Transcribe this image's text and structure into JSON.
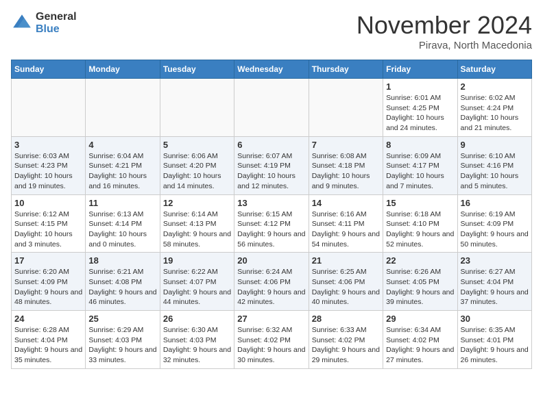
{
  "header": {
    "logo_general": "General",
    "logo_blue": "Blue",
    "month_title": "November 2024",
    "location": "Pirava, North Macedonia"
  },
  "days_of_week": [
    "Sunday",
    "Monday",
    "Tuesday",
    "Wednesday",
    "Thursday",
    "Friday",
    "Saturday"
  ],
  "weeks": [
    {
      "days": [
        {
          "num": "",
          "info": ""
        },
        {
          "num": "",
          "info": ""
        },
        {
          "num": "",
          "info": ""
        },
        {
          "num": "",
          "info": ""
        },
        {
          "num": "",
          "info": ""
        },
        {
          "num": "1",
          "info": "Sunrise: 6:01 AM\nSunset: 4:25 PM\nDaylight: 10 hours and 24 minutes."
        },
        {
          "num": "2",
          "info": "Sunrise: 6:02 AM\nSunset: 4:24 PM\nDaylight: 10 hours and 21 minutes."
        }
      ]
    },
    {
      "days": [
        {
          "num": "3",
          "info": "Sunrise: 6:03 AM\nSunset: 4:23 PM\nDaylight: 10 hours and 19 minutes."
        },
        {
          "num": "4",
          "info": "Sunrise: 6:04 AM\nSunset: 4:21 PM\nDaylight: 10 hours and 16 minutes."
        },
        {
          "num": "5",
          "info": "Sunrise: 6:06 AM\nSunset: 4:20 PM\nDaylight: 10 hours and 14 minutes."
        },
        {
          "num": "6",
          "info": "Sunrise: 6:07 AM\nSunset: 4:19 PM\nDaylight: 10 hours and 12 minutes."
        },
        {
          "num": "7",
          "info": "Sunrise: 6:08 AM\nSunset: 4:18 PM\nDaylight: 10 hours and 9 minutes."
        },
        {
          "num": "8",
          "info": "Sunrise: 6:09 AM\nSunset: 4:17 PM\nDaylight: 10 hours and 7 minutes."
        },
        {
          "num": "9",
          "info": "Sunrise: 6:10 AM\nSunset: 4:16 PM\nDaylight: 10 hours and 5 minutes."
        }
      ]
    },
    {
      "days": [
        {
          "num": "10",
          "info": "Sunrise: 6:12 AM\nSunset: 4:15 PM\nDaylight: 10 hours and 3 minutes."
        },
        {
          "num": "11",
          "info": "Sunrise: 6:13 AM\nSunset: 4:14 PM\nDaylight: 10 hours and 0 minutes."
        },
        {
          "num": "12",
          "info": "Sunrise: 6:14 AM\nSunset: 4:13 PM\nDaylight: 9 hours and 58 minutes."
        },
        {
          "num": "13",
          "info": "Sunrise: 6:15 AM\nSunset: 4:12 PM\nDaylight: 9 hours and 56 minutes."
        },
        {
          "num": "14",
          "info": "Sunrise: 6:16 AM\nSunset: 4:11 PM\nDaylight: 9 hours and 54 minutes."
        },
        {
          "num": "15",
          "info": "Sunrise: 6:18 AM\nSunset: 4:10 PM\nDaylight: 9 hours and 52 minutes."
        },
        {
          "num": "16",
          "info": "Sunrise: 6:19 AM\nSunset: 4:09 PM\nDaylight: 9 hours and 50 minutes."
        }
      ]
    },
    {
      "days": [
        {
          "num": "17",
          "info": "Sunrise: 6:20 AM\nSunset: 4:09 PM\nDaylight: 9 hours and 48 minutes."
        },
        {
          "num": "18",
          "info": "Sunrise: 6:21 AM\nSunset: 4:08 PM\nDaylight: 9 hours and 46 minutes."
        },
        {
          "num": "19",
          "info": "Sunrise: 6:22 AM\nSunset: 4:07 PM\nDaylight: 9 hours and 44 minutes."
        },
        {
          "num": "20",
          "info": "Sunrise: 6:24 AM\nSunset: 4:06 PM\nDaylight: 9 hours and 42 minutes."
        },
        {
          "num": "21",
          "info": "Sunrise: 6:25 AM\nSunset: 4:06 PM\nDaylight: 9 hours and 40 minutes."
        },
        {
          "num": "22",
          "info": "Sunrise: 6:26 AM\nSunset: 4:05 PM\nDaylight: 9 hours and 39 minutes."
        },
        {
          "num": "23",
          "info": "Sunrise: 6:27 AM\nSunset: 4:04 PM\nDaylight: 9 hours and 37 minutes."
        }
      ]
    },
    {
      "days": [
        {
          "num": "24",
          "info": "Sunrise: 6:28 AM\nSunset: 4:04 PM\nDaylight: 9 hours and 35 minutes."
        },
        {
          "num": "25",
          "info": "Sunrise: 6:29 AM\nSunset: 4:03 PM\nDaylight: 9 hours and 33 minutes."
        },
        {
          "num": "26",
          "info": "Sunrise: 6:30 AM\nSunset: 4:03 PM\nDaylight: 9 hours and 32 minutes."
        },
        {
          "num": "27",
          "info": "Sunrise: 6:32 AM\nSunset: 4:02 PM\nDaylight: 9 hours and 30 minutes."
        },
        {
          "num": "28",
          "info": "Sunrise: 6:33 AM\nSunset: 4:02 PM\nDaylight: 9 hours and 29 minutes."
        },
        {
          "num": "29",
          "info": "Sunrise: 6:34 AM\nSunset: 4:02 PM\nDaylight: 9 hours and 27 minutes."
        },
        {
          "num": "30",
          "info": "Sunrise: 6:35 AM\nSunset: 4:01 PM\nDaylight: 9 hours and 26 minutes."
        }
      ]
    }
  ]
}
